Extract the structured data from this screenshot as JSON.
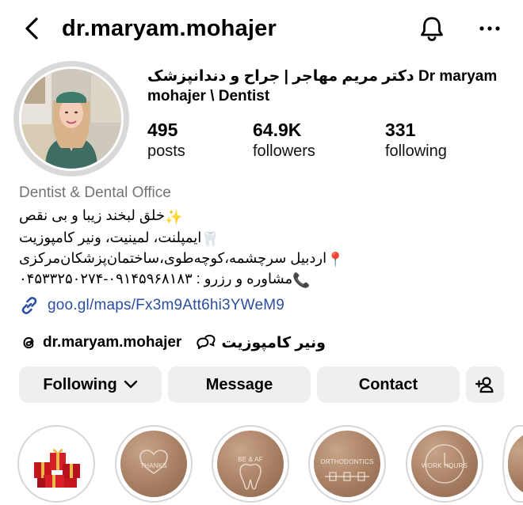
{
  "header": {
    "username": "dr.maryam.mohajer"
  },
  "profile": {
    "display_name": "دکتر مریم مهاجر | جراح و دندانپزشک Dr maryam mohajer \\ Dentist",
    "stats": [
      {
        "count": "495",
        "label": "posts"
      },
      {
        "count": "64.9K",
        "label": "followers"
      },
      {
        "count": "331",
        "label": "following"
      }
    ],
    "category": "Dentist & Dental Office",
    "bio_lines": [
      {
        "emoji": "✨",
        "text": "خلق لبخند زیبا و بی نقص"
      },
      {
        "emoji": "🦷",
        "text": "ایمپلنت، لمینیت، ونیر کامپوزیت"
      },
      {
        "emoji": "📍",
        "text": "اردبیل سرچشمه،کوچه‌طوی،ساختمان‌پزشکان‌مرکزی"
      },
      {
        "emoji": "📞",
        "text": "مشاوره و رزرو : ۰۹۱۴۵۹۶۸۱۸۳-۰۴۵۳۳۲۵۰۲۷۴"
      }
    ],
    "link": "goo.gl/maps/Fx3m9Att6hi3YWeM9",
    "threads_handle": "dr.maryam.mohajer",
    "channel_name": "ونیر کامپوزیت"
  },
  "actions": {
    "following_label": "Following",
    "message_label": "Message",
    "contact_label": "Contact"
  },
  "highlights": [
    {
      "label": ""
    },
    {
      "label": "THANKS"
    },
    {
      "label": "BE & AF"
    },
    {
      "label": "ORTHODONTICS"
    },
    {
      "label": "WORK HOURS"
    }
  ],
  "colors": {
    "link": "#2a4ea1",
    "button_bg": "#efefef",
    "secondary_text": "#737373",
    "highlight_bronze": "#a77f63"
  }
}
